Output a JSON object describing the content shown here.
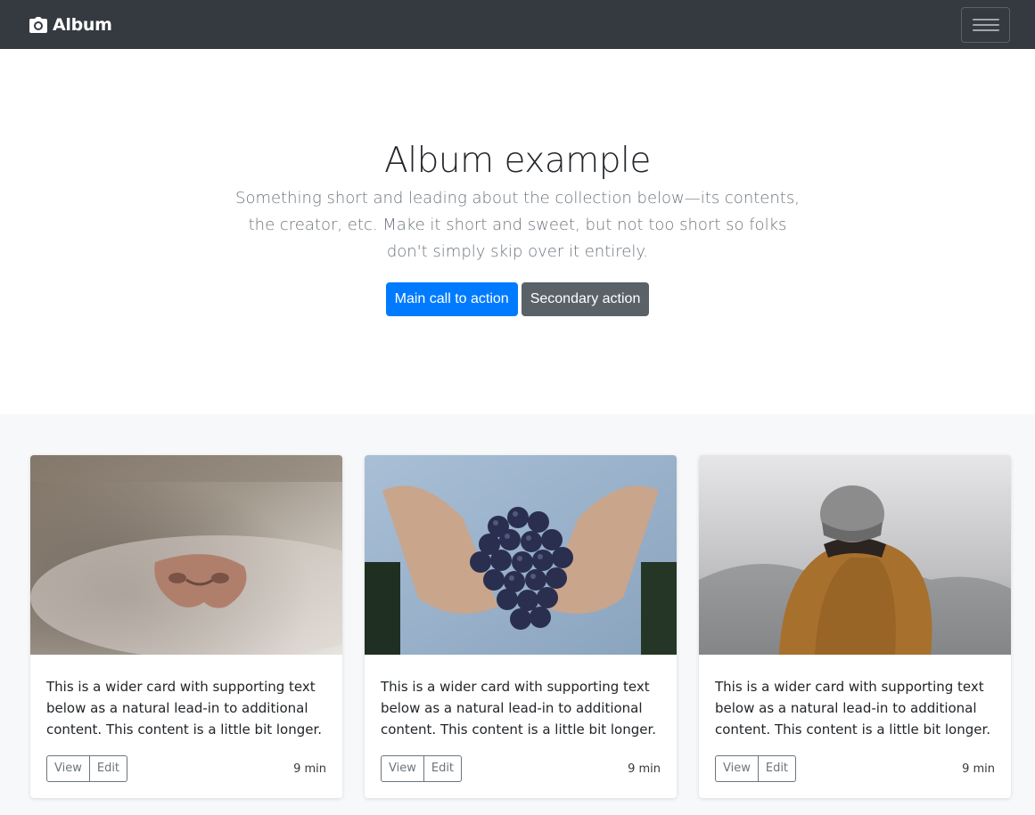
{
  "navbar": {
    "brand": "Album",
    "brand_icon": "camera-icon",
    "toggler_icon": "hamburger-menu-icon"
  },
  "jumbotron": {
    "heading": "Album example",
    "lead": "Something short and leading about the collection below—its contents, the creator, etc. Make it short and sweet, but not too short so folks don't simply skip over it entirely.",
    "primary_action": "Main call to action",
    "secondary_action": "Secondary action"
  },
  "cards": [
    {
      "image": "cat-nose-photo",
      "text": "This is a wider card with supporting text below as a natural lead-in to additional content. This content is a little bit longer.",
      "view": "View",
      "edit": "Edit",
      "time": "9 min"
    },
    {
      "image": "hands-holding-grapes-photo",
      "text": "This is a wider card with supporting text below as a natural lead-in to additional content. This content is a little bit longer.",
      "view": "View",
      "edit": "Edit",
      "time": "9 min"
    },
    {
      "image": "person-in-beanie-photo",
      "text": "This is a wider card with supporting text below as a natural lead-in to additional content. This content is a little bit longer.",
      "view": "View",
      "edit": "Edit",
      "time": "9 min"
    }
  ],
  "colors": {
    "navbar_bg": "#343a40",
    "primary": "#007bff",
    "secondary": "#5a6268",
    "album_bg": "#f7f8f9"
  }
}
